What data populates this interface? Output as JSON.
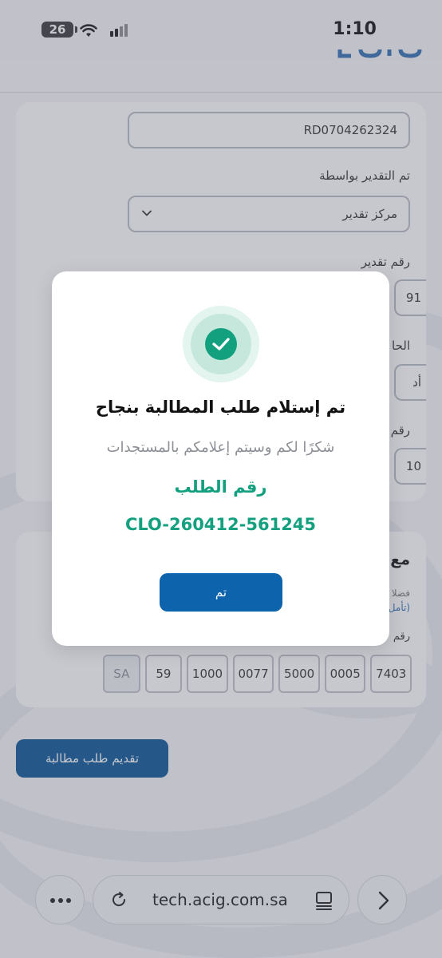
{
  "status_bar": {
    "battery_level": "26",
    "time": "1:10"
  },
  "form": {
    "reference_value": "RD0704262324",
    "estimated_by_label": "تم التقدير بواسطة",
    "estimated_by_value": "مركز تقدير",
    "estimate_number_label": "رقم تقدير",
    "estimate_number_partial": "91",
    "field_stub_label_1": "الحا",
    "field_stub_value_1": "أد",
    "field_stub_label_2": "رقم",
    "field_stub_value_2": "10",
    "section_heading_partial": "مع",
    "hint_partial_1": "فضلا",
    "hint_partial_2": "(تأمل",
    "iban_label_partial": "رقم",
    "iban_cells": [
      "SA",
      "59",
      "1000",
      "0077",
      "5000",
      "0005",
      "7403"
    ],
    "submit_label": "تقديم طلب مطالبة"
  },
  "modal": {
    "icon": "check-circle-icon",
    "title": "تم إستلام طلب المطالبة بنجاح",
    "subtitle": "شكرًا لكم وسيتم إعلامكم بالمستجدات",
    "ref_label": "رقم الطلب",
    "ref_number": "CLO-260412-561245",
    "ok_label": "تم",
    "success_color": "#13a07f",
    "button_color": "#0d64ad"
  },
  "browser": {
    "url": "tech.acig.com.sa"
  }
}
